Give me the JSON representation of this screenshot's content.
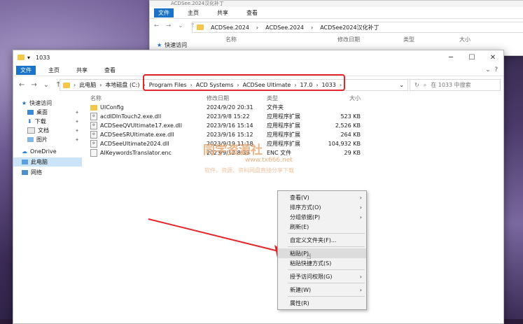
{
  "back_window": {
    "title": "ACDSee.2024汉化补丁",
    "tabs": [
      "文件",
      "主页",
      "共享",
      "查看"
    ],
    "address": [
      "ACDSee.2024",
      "ACDSee.2024",
      "ACDSee2024汉化补丁"
    ],
    "columns": [
      "名称",
      "修改日期",
      "类型",
      "大小"
    ],
    "side_item": "快速访问"
  },
  "window": {
    "title": "1033",
    "tabs": [
      "文件",
      "主页",
      "共享",
      "查看"
    ],
    "address": {
      "root": "此电脑",
      "disk": "本地磁盘 (C:)",
      "crumbs": [
        "Program Files",
        "ACD Systems",
        "ACDSee Ultimate",
        "17.0",
        "1033"
      ]
    },
    "search_placeholder": "在 1033 中搜索"
  },
  "sidebar": {
    "items": [
      {
        "label": "快速访问"
      },
      {
        "label": "桌面"
      },
      {
        "label": "下载"
      },
      {
        "label": "文档"
      },
      {
        "label": "图片"
      },
      {
        "label": "OneDrive"
      },
      {
        "label": "此电脑"
      },
      {
        "label": "网络"
      }
    ]
  },
  "file_list": {
    "headers": {
      "name": "名称",
      "date": "修改日期",
      "type": "类型",
      "size": "大小"
    },
    "rows": [
      {
        "name": "UIConfig",
        "date": "2024/9/20 20:31",
        "type": "文件夹",
        "size": ""
      },
      {
        "name": "acdIDInTouch2.exe.dll",
        "date": "2023/9/8 15:22",
        "type": "应用程序扩展",
        "size": "523 KB"
      },
      {
        "name": "ACDSeeQVUltimate17.exe.dll",
        "date": "2023/9/16 15:14",
        "type": "应用程序扩展",
        "size": "2,526 KB"
      },
      {
        "name": "ACDSeeSRUltimate.exe.dll",
        "date": "2023/9/16 15:12",
        "type": "应用程序扩展",
        "size": "264 KB"
      },
      {
        "name": "ACDSeeUltimate2024.dll",
        "date": "2023/9/19 11:18",
        "type": "应用程序扩展",
        "size": "104,932 KB"
      },
      {
        "name": "AIKeywordsTranslator.enc",
        "date": "2023/9/12 8:39",
        "type": "ENC 文件",
        "size": "29 KB"
      }
    ]
  },
  "watermark": {
    "line1": "同学资源社",
    "line2": "www.tx666.net",
    "line3": "软件、资源、资料网盘直接分享下载"
  },
  "context_menu": {
    "items": [
      {
        "label": "查看(V)",
        "submenu": true
      },
      {
        "label": "排序方式(O)",
        "submenu": true
      },
      {
        "label": "分组依据(P)",
        "submenu": true
      },
      {
        "label": "刷新(E)",
        "submenu": false
      },
      {
        "label": "自定义文件夹(F)...",
        "submenu": false
      },
      {
        "label": "粘贴(P)",
        "submenu": false
      },
      {
        "label": "粘贴快捷方式(S)",
        "submenu": false
      },
      {
        "label": "授予访问权限(G)",
        "submenu": true
      },
      {
        "label": "新建(W)",
        "submenu": true
      },
      {
        "label": "属性(R)",
        "submenu": false
      }
    ]
  },
  "colors": {
    "accent": "#1a73c9",
    "highlight_box": "#e3262b",
    "arrow": "#e3262b"
  }
}
